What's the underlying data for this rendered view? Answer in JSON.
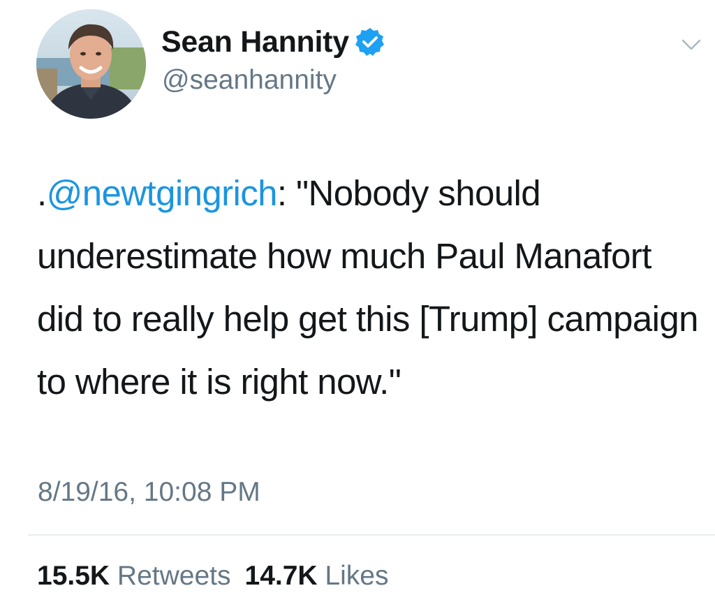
{
  "user": {
    "display_name": "Sean Hannity",
    "handle": "@seanhannity",
    "verified": true,
    "avatar_icon": "profile-photo"
  },
  "tweet": {
    "prefix": ".",
    "mention": "@newtgingrich",
    "text_after_mention": ": \"Nobody should underestimate how much Paul Manafort did to really help get this [Trump] campaign to where it is right now.\"",
    "timestamp": "8/19/16, 10:08 PM"
  },
  "stats": {
    "retweets_count": "15.5K",
    "retweets_label": "Retweets",
    "likes_count": "14.7K",
    "likes_label": "Likes"
  },
  "menu": {
    "icon": "chevron-down-icon"
  },
  "colors": {
    "link": "#1b95e0",
    "verified": "#1da1f2",
    "secondary_text": "#657786",
    "primary_text": "#14171a",
    "divider": "#e6ecf0"
  }
}
